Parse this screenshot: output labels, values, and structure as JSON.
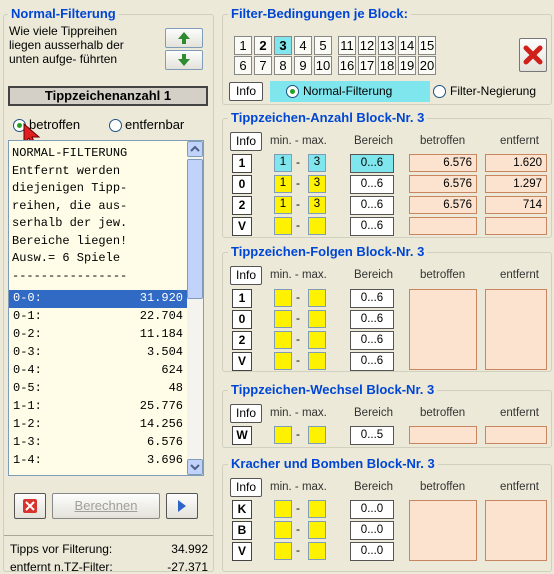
{
  "left_panel": {
    "title": "Normal-Filterung",
    "question": [
      "Wie viele Tippreihen",
      "liegen ausserhalb der",
      "unten aufge- führten"
    ],
    "up_icon": "arrow-up-icon",
    "down_icon": "arrow-down-icon",
    "count_label": "Tippzeichenanzahl 1",
    "radio_betroffen": "betroffen",
    "radio_entfernbar": "entfernbar",
    "info_text": [
      "NORMAL-FILTERUNG",
      "Entfernt werden",
      "diejenigen Tipp-",
      "reihen, die aus-",
      "serhalb der jew.",
      "Bereiche liegen!",
      "Ausw.=  6 Spiele",
      "----------------"
    ],
    "list": [
      {
        "label": "0-0:",
        "value": "31.920",
        "selected": true
      },
      {
        "label": "0-1:",
        "value": "22.704"
      },
      {
        "label": "0-2:",
        "value": "11.184"
      },
      {
        "label": "0-3:",
        "value": "3.504"
      },
      {
        "label": "0-4:",
        "value": "624"
      },
      {
        "label": "0-5:",
        "value": "48"
      },
      {
        "label": "1-1:",
        "value": "25.776"
      },
      {
        "label": "1-2:",
        "value": "14.256"
      },
      {
        "label": "1-3:",
        "value": "6.576"
      },
      {
        "label": "1-4:",
        "value": "3.696"
      }
    ],
    "cancel_icon": "close-icon",
    "berechnen_label": "Berechnen",
    "next_icon": "play-icon",
    "status": [
      {
        "label": "Tipps vor Filterung:",
        "value": "34.992"
      },
      {
        "label": "entfernt n.TZ-Filter:",
        "value": "-27.371"
      }
    ]
  },
  "filter_block": {
    "title": "Filter-Bedingungen je Block:",
    "row1": [
      "1",
      "2",
      "3",
      "4",
      "5",
      "11",
      "12",
      "13",
      "14",
      "15"
    ],
    "row2": [
      "6",
      "7",
      "8",
      "9",
      "10",
      "16",
      "17",
      "18",
      "19",
      "20"
    ],
    "selected": "3",
    "delete_icon": "delete-x-icon",
    "info_label": "Info",
    "radio_normal": "Normal-Filterung",
    "radio_negation": "Filter-Negierung"
  },
  "headers": {
    "info": "Info",
    "minmax": "min. - max.",
    "bereich": "Bereich",
    "betroffen": "betroffen",
    "entfernt": "entfernt"
  },
  "anzahl": {
    "title": "Tippzeichen-Anzahl Block-Nr. 3",
    "rows": [
      {
        "key": "1",
        "min": "1",
        "max": "3",
        "range": "0...6",
        "betroffen": "6.576",
        "entfernt": "1.620"
      },
      {
        "key": "0",
        "min": "1",
        "max": "3",
        "range": "0...6",
        "betroffen": "6.576",
        "entfernt": "1.297"
      },
      {
        "key": "2",
        "min": "1",
        "max": "3",
        "range": "0...6",
        "betroffen": "6.576",
        "entfernt": "714"
      },
      {
        "key": "V",
        "min": "",
        "max": "",
        "range": "0...6",
        "betroffen": "",
        "entfernt": ""
      }
    ]
  },
  "folgen": {
    "title": "Tippzeichen-Folgen Block-Nr. 3",
    "rows": [
      {
        "key": "1",
        "range": "0...6"
      },
      {
        "key": "0",
        "range": "0...6"
      },
      {
        "key": "2",
        "range": "0...6"
      },
      {
        "key": "V",
        "range": "0...6"
      }
    ]
  },
  "wechsel": {
    "title": "Tippzeichen-Wechsel Block-Nr. 3",
    "rows": [
      {
        "key": "W",
        "range": "0...5"
      }
    ]
  },
  "kracher": {
    "title": "Kracher und Bomben Block-Nr. 3",
    "rows": [
      {
        "key": "K",
        "range": "0...0"
      },
      {
        "key": "B",
        "range": "0...0"
      },
      {
        "key": "V",
        "range": "0...0"
      }
    ]
  }
}
